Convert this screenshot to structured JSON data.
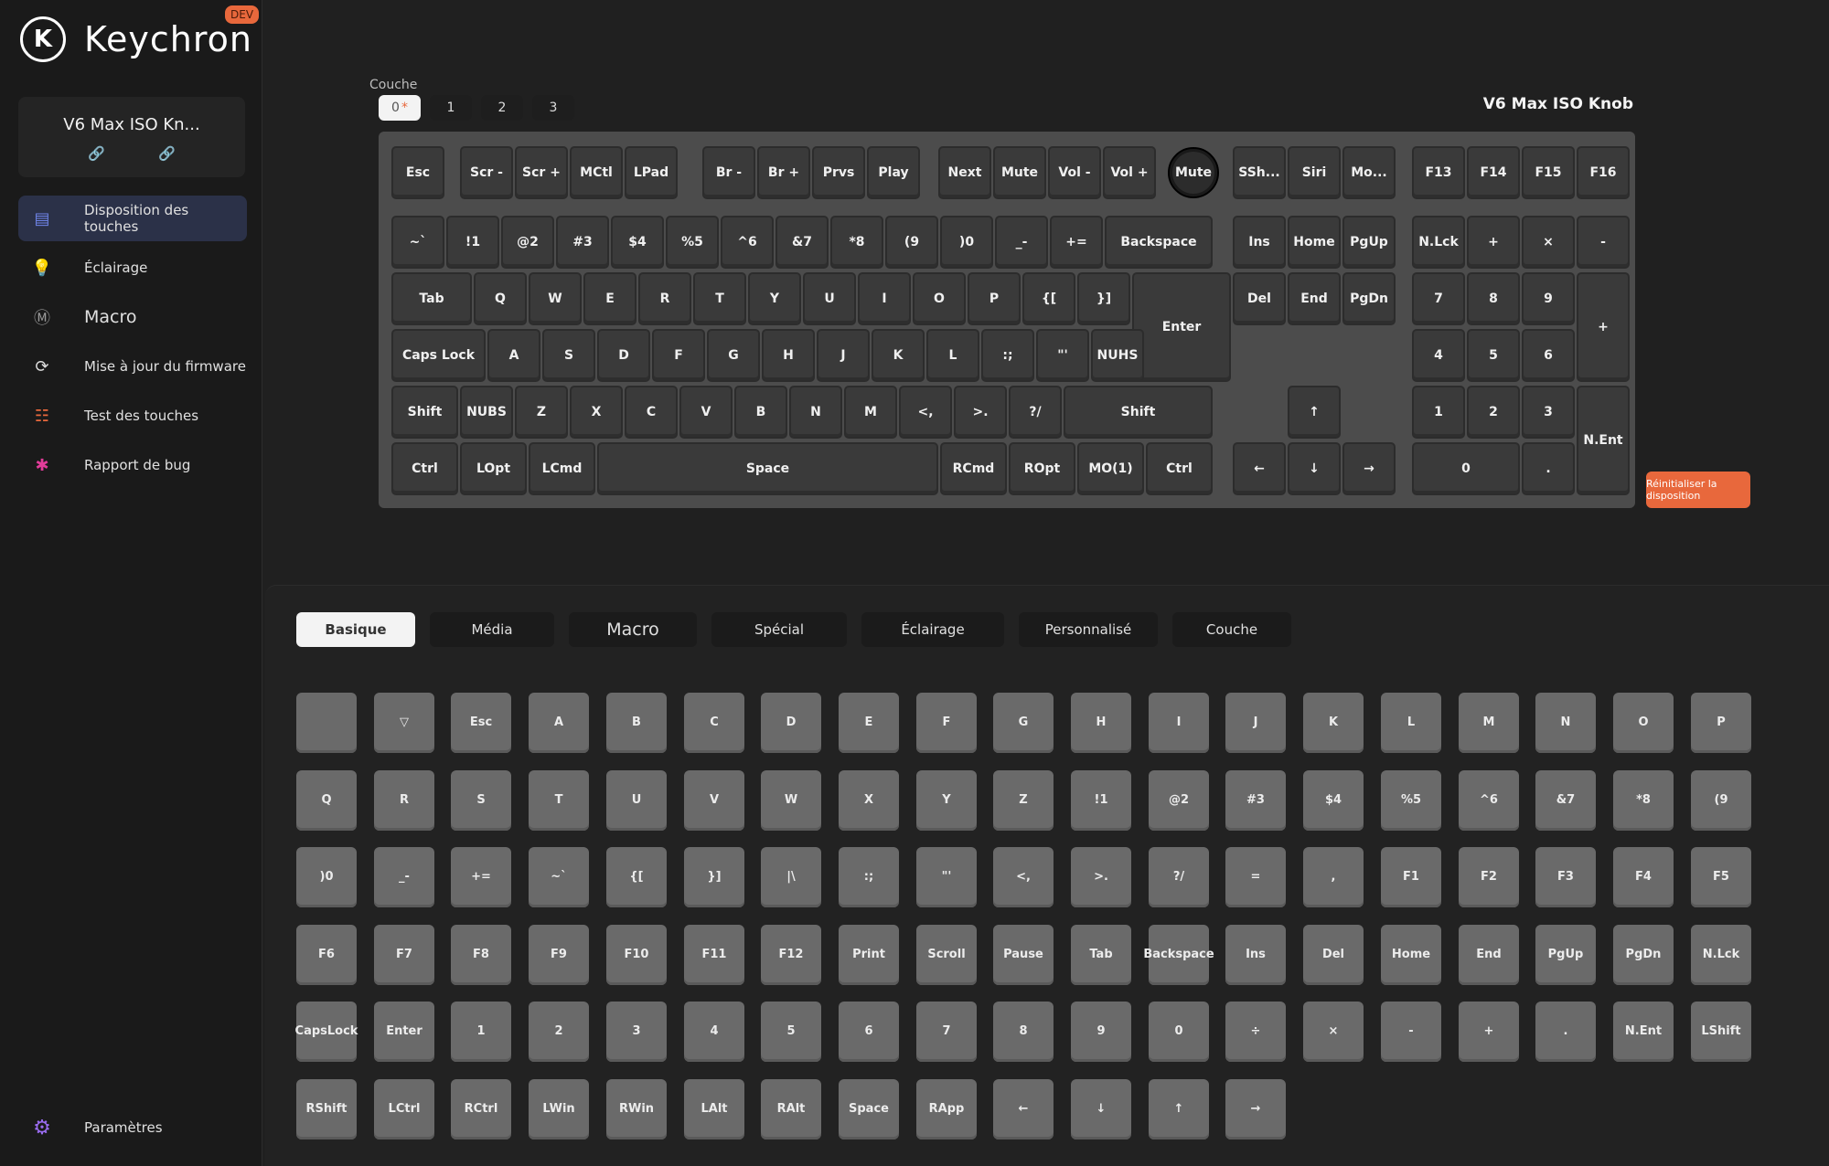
{
  "brand": {
    "name": "Keychron",
    "logo": "K",
    "badge": "DEV"
  },
  "device": {
    "name": "V6 Max ISO Kn...",
    "link1": "🔗",
    "link2": "🔗"
  },
  "nav": [
    {
      "id": "keymap",
      "label": "Disposition des touches",
      "icon": "keyboard-icon",
      "glyph": "▤",
      "color": "#6f84e8",
      "active": true
    },
    {
      "id": "lighting",
      "label": "Éclairage",
      "icon": "lightbulb-icon",
      "glyph": "💡",
      "color": "#6fd36b"
    },
    {
      "id": "macro",
      "label": "Macro",
      "icon": "macro-icon",
      "glyph": "Ⓜ",
      "color": "#9c9c9c"
    },
    {
      "id": "firmware",
      "label": "Mise à jour du firmware",
      "icon": "firmware-update-icon",
      "glyph": "⟳",
      "color": "#dcdcdc"
    },
    {
      "id": "keytest",
      "label": "Test des touches",
      "icon": "key-test-icon",
      "glyph": "☷",
      "color": "#e8683c"
    },
    {
      "id": "bug",
      "label": "Rapport de bug",
      "icon": "bug-icon",
      "glyph": "✱",
      "color": "#e23c9a"
    }
  ],
  "settings": {
    "label": "Paramètres",
    "icon": "gear-icon",
    "glyph": "⚙"
  },
  "layer": {
    "label": "Couche",
    "buttons": [
      {
        "label": "0",
        "star": "*",
        "active": true
      },
      {
        "label": "1"
      },
      {
        "label": "2"
      },
      {
        "label": "3"
      }
    ]
  },
  "keyboard_title": "V6 Max ISO Knob",
  "reset_label": "Réinitialiser la disposition",
  "colors": {
    "accent": "#e8683c",
    "active_nav": "#2b3148",
    "keycap": "#3a3a3a",
    "grid_key": "#6a6a6a"
  },
  "keyboard_keys": [
    "Esc",
    "Scr -",
    "Scr +",
    "MCtl",
    "LPad",
    "Br -",
    "Br +",
    "Prvs",
    "Play",
    "Next",
    "Mute",
    "Vol -",
    "Vol +",
    "Mute",
    "SSh...",
    "Siri",
    "Mo...",
    "F13",
    "F14",
    "F15",
    "F16",
    "~\n`",
    "!\n1",
    "@\n2",
    "#\n3",
    "$\n4",
    "%\n5",
    "^\n6",
    "&\n7",
    "*\n8",
    "(\n9",
    ")\n0",
    "_\n-",
    "+\n=",
    "Backspace",
    "Ins",
    "Home",
    "PgUp",
    "N.Lck",
    "+",
    "×",
    "-",
    "Tab",
    "Q",
    "W",
    "E",
    "R",
    "T",
    "Y",
    "U",
    "I",
    "O",
    "P",
    "{\n[",
    "}\n]",
    "Enter",
    "Del",
    "End",
    "PgDn",
    "7",
    "8",
    "9",
    "+",
    "Caps Lock",
    "A",
    "S",
    "D",
    "F",
    "G",
    "H",
    "J",
    "K",
    "L",
    ":\n;",
    "\"\n'",
    "NUHS",
    "4",
    "5",
    "6",
    "Shift",
    "NUBS",
    "Z",
    "X",
    "C",
    "V",
    "B",
    "N",
    "M",
    "<\n,",
    ">\n.",
    "?\n/",
    "Shift",
    "↑",
    "1",
    "2",
    "3",
    "N.Ent",
    "Ctrl",
    "LOpt",
    "LCmd",
    "Space",
    "RCmd",
    "ROpt",
    "MO(1)",
    "Ctrl",
    "←",
    "↓",
    "→",
    "0",
    "."
  ],
  "tabs": [
    "Basique",
    "Média",
    "Macro",
    "Spécial",
    "Éclairage",
    "Personnalisé",
    "Couche"
  ],
  "grid_keys": [
    "",
    "▽",
    "Esc",
    "A",
    "B",
    "C",
    "D",
    "E",
    "F",
    "G",
    "H",
    "I",
    "J",
    "K",
    "L",
    "M",
    "N",
    "O",
    "P",
    "Q",
    "R",
    "S",
    "T",
    "U",
    "V",
    "W",
    "X",
    "Y",
    "Z",
    "!\n1",
    "@\n2",
    "#\n3",
    "$\n4",
    "%\n5",
    "^\n6",
    "&\n7",
    "*\n8",
    "(\n9",
    ")\n0",
    "_\n-",
    "+\n=",
    "~\n`",
    "{\n[",
    "}\n]",
    "|\n\\",
    ":\n;",
    "\"\n'",
    "<\n,",
    ">\n.",
    "?\n/",
    "=",
    ",",
    "F1",
    "F2",
    "F3",
    "F4",
    "F5",
    "F6",
    "F7",
    "F8",
    "F9",
    "F10",
    "F11",
    "F12",
    "Print",
    "Scroll",
    "Pause",
    "Tab",
    "Backsp\nace",
    "Ins",
    "Del",
    "Home",
    "End",
    "PgUp",
    "PgDn",
    "N.Lck",
    "Caps\nLock",
    "Enter",
    "1",
    "2",
    "3",
    "4",
    "5",
    "6",
    "7",
    "8",
    "9",
    "0",
    "÷",
    "×",
    "-",
    "+",
    ".",
    "N.Ent",
    "LShift",
    "RShift",
    "LCtrl",
    "RCtrl",
    "LWin",
    "RWin",
    "LAlt",
    "RAlt",
    "Space",
    "RApp",
    "←",
    "↓",
    "↑",
    "→"
  ]
}
